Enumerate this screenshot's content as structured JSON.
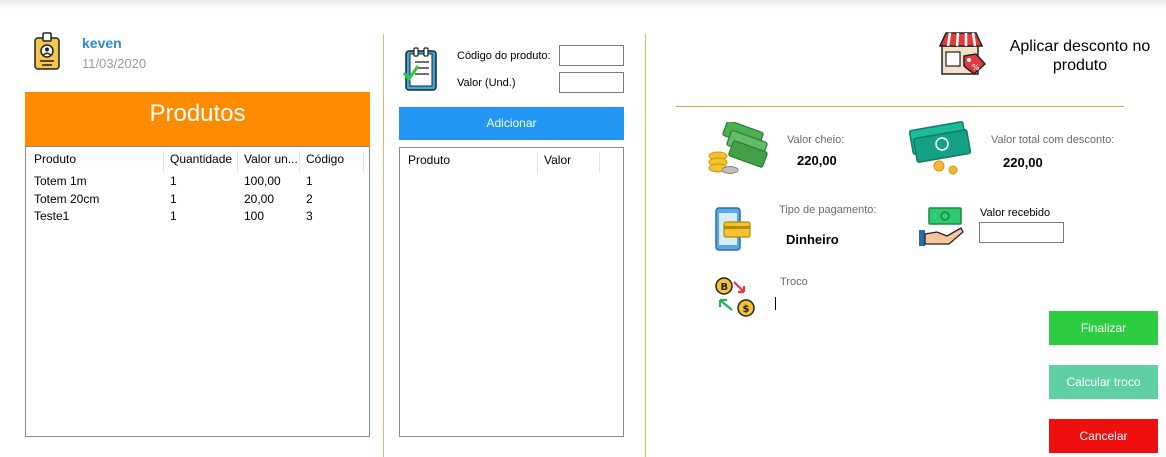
{
  "user": {
    "name": "keven",
    "date": "11/03/2020"
  },
  "produtos": {
    "title": "Produtos",
    "columns": [
      "Produto",
      "Quantidade",
      "Valor un...",
      "Código"
    ],
    "rows": [
      [
        "Totem 1m",
        "1",
        "100,00",
        "1"
      ],
      [
        "Totem 20cm",
        "1",
        "20,00",
        "2"
      ],
      [
        "Teste1",
        "1",
        "100",
        "3"
      ]
    ]
  },
  "entry": {
    "codigo_label": "Código do produto:",
    "codigo_value": "",
    "valor_label": "Valor (Und.)",
    "valor_value": "",
    "add_button": "Adicionar",
    "list_columns": [
      "Produto",
      "Valor"
    ]
  },
  "desconto": {
    "title": "Aplicar desconto no produto"
  },
  "summary": {
    "valor_cheio_label": "Valor cheio:",
    "valor_cheio": "220,00",
    "valor_total_label": "Valor total com desconto:",
    "valor_total": "220,00",
    "tipo_pagamento_label": "Tipo de pagamento:",
    "tipo_pagamento": "Dinheiro",
    "valor_recebido_label": "Valor recebido",
    "valor_recebido": "",
    "troco_label": "Troco",
    "troco": ""
  },
  "actions": {
    "finalizar": "Finalizar",
    "calcular": "Calcular troco",
    "cancelar": "Cancelar"
  },
  "colors": {
    "accent_orange": "#ff8c00",
    "accent_blue": "#2196f3",
    "finalizar": "#2ecc40",
    "calcular": "#5fd0a4",
    "cancelar": "#f00f0f"
  },
  "icons": [
    "id-badge-icon",
    "clipboard-checklist-icon",
    "shop-discount-icon",
    "money-stack-icon",
    "cash-coins-icon",
    "mobile-payment-icon",
    "hand-cash-icon",
    "coin-exchange-icon"
  ]
}
